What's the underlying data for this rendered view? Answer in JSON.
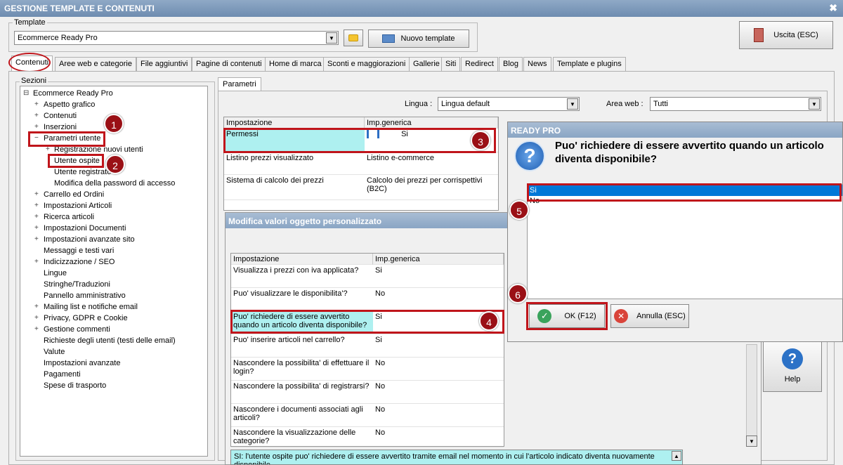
{
  "window": {
    "title": "GESTIONE TEMPLATE E CONTENUTI",
    "close": "✖"
  },
  "template": {
    "group_label": "Template",
    "selected": "Ecommerce Ready Pro",
    "new_button": "Nuovo template"
  },
  "exit_button": "Uscita (ESC)",
  "tabs": [
    "Contenuti",
    "Aree web e categorie",
    "File aggiuntivi",
    "Pagine di contenuti",
    "Home di marca",
    "Sconti e maggiorazioni",
    "Gallerie",
    "Siti",
    "Redirect",
    "Blog",
    "News",
    "Template e plugins"
  ],
  "sections": {
    "label": "Sezioni",
    "root": "Ecommerce Ready Pro",
    "items": [
      "Aspetto grafico",
      "Contenuti",
      "Inserzioni",
      "Parametri utente",
      "Registrazione nuovi utenti",
      "Utente ospite",
      "Utente registrato",
      "Modifica della password di accesso",
      "Carrello ed Ordini",
      "Impostazioni Articoli",
      "Ricerca articoli",
      "Impostazioni Documenti",
      "Impostazioni avanzate sito",
      "Messaggi e testi vari",
      "Indicizzazione / SEO",
      "Lingue",
      "Stringhe/Traduzioni",
      "Pannello amministrativo",
      "Mailing list e notifiche email",
      "Privacy, GDPR e Cookie",
      "Gestione commenti",
      "Richieste degli utenti (testi delle email)",
      "Valute",
      "Impostazioni avanzate",
      "Pagamenti",
      "Spese di trasporto"
    ]
  },
  "params": {
    "tab": "Parametri",
    "lingua_label": "Lingua :",
    "lingua_value": "Lingua default",
    "area_label": "Area web :",
    "area_value": "Tutti",
    "col1": "Impostazione",
    "col2": "Imp.generica",
    "rows": [
      {
        "name": "Permessi",
        "value": "Si"
      },
      {
        "name": "Listino prezzi visualizzato",
        "value": "Listino e-commerce"
      },
      {
        "name": "Sistema di calcolo dei prezzi",
        "value": "Calcolo dei prezzi per corrispettivi (B2C)"
      }
    ]
  },
  "modifica": {
    "title": "Modifica valori oggetto personalizzato",
    "col1": "Impostazione",
    "col2": "Imp.generica",
    "rows": [
      {
        "name": "Visualizza i prezzi con iva applicata?",
        "value": "Si"
      },
      {
        "name": "Puo' visualizzare le disponibilita'?",
        "value": "No"
      },
      {
        "name": "Puo' richiedere di essere avvertito quando un articolo diventa disponibile?",
        "value": "Si"
      },
      {
        "name": "Puo' inserire articoli nel carrello?",
        "value": "Si"
      },
      {
        "name": "Nascondere la possibilita' di effettuare il login?",
        "value": "No"
      },
      {
        "name": "Nascondere la possibilita' di registrarsi?",
        "value": "No"
      },
      {
        "name": "Nascondere i documenti associati agli articoli?",
        "value": "No"
      },
      {
        "name": "Nascondere la visualizzazione delle categorie?",
        "value": "No"
      }
    ],
    "description": "SI: l'utente ospite puo' richiedere di essere avvertito tramite email nel momento in cui l'articolo indicato diventa nuovamente disponibile"
  },
  "ready_dialog": {
    "title": "READY PRO",
    "question": "Puo' richiedere di essere avvertito quando un articolo diventa disponibile?",
    "options": [
      "Si",
      "No"
    ],
    "ok": "OK (F12)",
    "cancel": "Annulla (ESC)"
  },
  "help_label": "Help",
  "badges": [
    "1",
    "2",
    "3",
    "4",
    "5",
    "6"
  ],
  "colors": {
    "selection": "#0078d7",
    "highlight": "#aef0f0",
    "annotation": "#c0151b"
  }
}
